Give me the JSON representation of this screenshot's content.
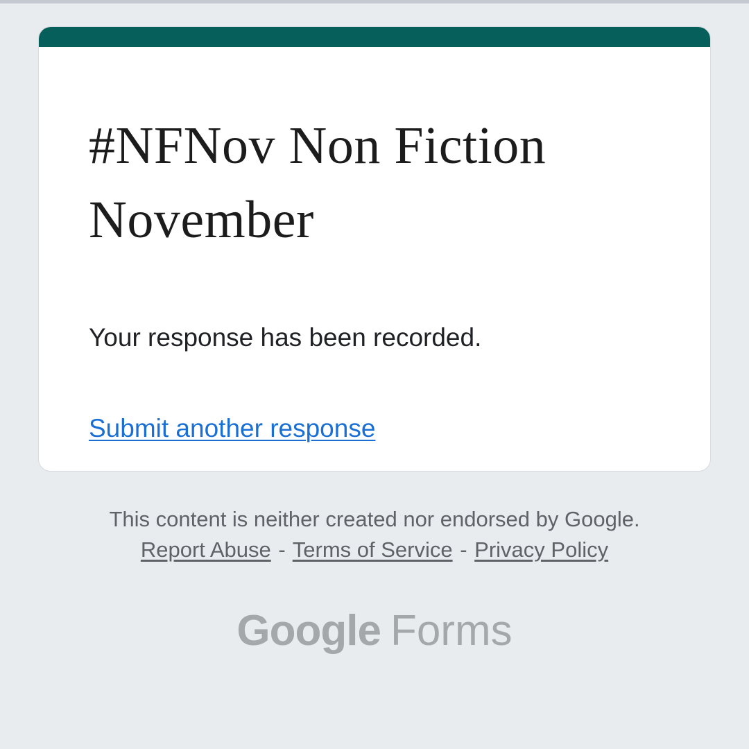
{
  "form": {
    "title": "#NFNov Non Fiction November",
    "accent_color": "#075f5c",
    "confirmation_message": "Your response has been recorded.",
    "submit_another_label": "Submit another response"
  },
  "footer": {
    "disclaimer": "This content is neither created nor endorsed by Google.",
    "links": {
      "report_abuse": "Report Abuse",
      "terms": "Terms of Service",
      "privacy": "Privacy Policy"
    },
    "separator": "-"
  },
  "brand": {
    "google": "Google",
    "product": "Forms"
  },
  "colors": {
    "background": "#e8ecef",
    "link_blue": "#1a6fd4",
    "footer_text": "#5f6368",
    "logo_gray": "#a5a8ab"
  }
}
